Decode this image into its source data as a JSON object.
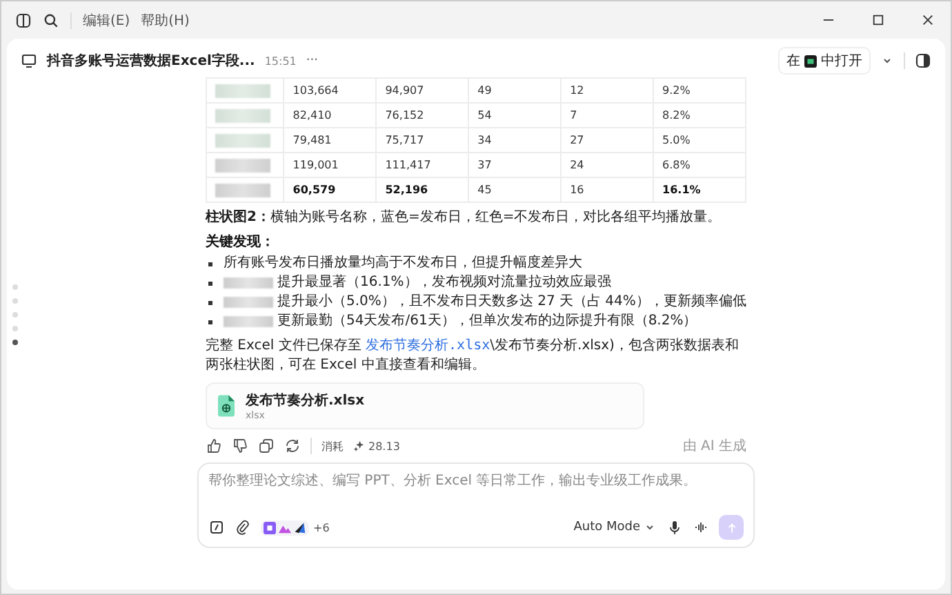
{
  "menu": [
    "编辑(E)",
    "帮助(H)"
  ],
  "conversation": {
    "title": "抖音多账号运营数据Excel字段...",
    "time": "15:51",
    "more": "···",
    "open_in": {
      "before": "在",
      "after": "中打开"
    }
  },
  "timeline": [
    {
      "selected": false
    },
    {
      "selected": false
    },
    {
      "selected": false
    },
    {
      "selected": false
    },
    {
      "selected": true
    }
  ],
  "table": {
    "rows": [
      {
        "cells": [
          {
            "text": "103,664",
            "bold": false
          },
          {
            "text": "94,907",
            "bold": false
          },
          {
            "text": "49",
            "bold": false
          },
          {
            "text": "12",
            "bold": false
          },
          {
            "text": "9.2%",
            "bold": false
          }
        ]
      },
      {
        "cells": [
          {
            "text": "82,410",
            "bold": false
          },
          {
            "text": "76,152",
            "bold": false
          },
          {
            "text": "54",
            "bold": false
          },
          {
            "text": "7",
            "bold": false
          },
          {
            "text": "8.2%",
            "bold": false
          }
        ]
      },
      {
        "cells": [
          {
            "text": "79,481",
            "bold": false
          },
          {
            "text": "75,717",
            "bold": false
          },
          {
            "text": "34",
            "bold": false
          },
          {
            "text": "27",
            "bold": false
          },
          {
            "text": "5.0%",
            "bold": false
          }
        ]
      },
      {
        "cells": [
          {
            "text": "119,001",
            "bold": false
          },
          {
            "text": "111,417",
            "bold": false
          },
          {
            "text": "37",
            "bold": false
          },
          {
            "text": "24",
            "bold": false
          },
          {
            "text": "6.8%",
            "bold": false
          }
        ]
      },
      {
        "cells": [
          {
            "text": "60,579",
            "bold": true
          },
          {
            "text": "52,196",
            "bold": true
          },
          {
            "text": "45",
            "bold": false
          },
          {
            "text": "16",
            "bold": false
          },
          {
            "text": "16.1%",
            "bold": true
          }
        ]
      }
    ]
  },
  "chart_note": "**柱状图2：**横轴为账号名称，蓝色=发布日，红色=不发布日，对比各组平均播放量。",
  "findings_heading": "关键发现：",
  "findings": [
    {
      "redacted_name": false,
      "text": "所有账号发布日播放量均高于不发布日，但提升幅度差异大"
    },
    {
      "redacted_name": true,
      "text": "提升最显著（16.1%），发布视频对流量拉动效应最强"
    },
    {
      "redacted_name": true,
      "text": "提升最小（5.0%），且不发布日天数多达 27 天（占 44%），更新频率偏低"
    },
    {
      "redacted_name": true,
      "text": "更新最勤（54天发布/61天），但单次发布的边际提升有限（8.2%）"
    }
  ],
  "saved": {
    "before": "完整 Excel 文件已保存至 ",
    "link": "发布节奏分析.xlsx",
    "after": "\\发布节奏分析.xlsx)，包含两张数据表和两张柱状图，可在 Excel 中直接查看和编辑。"
  },
  "file": {
    "name": "发布节奏分析.xlsx",
    "type": "xlsx"
  },
  "usage": {
    "label": "消耗",
    "value": "28.13"
  },
  "ai_note": "由 AI 生成",
  "composer": {
    "placeholder": "帮你整理论文综述、编写 PPT、分析 Excel 等日常工作，输出专业级工作成果。",
    "more_apps": "+6",
    "mode": "Auto Mode",
    "send_disabled": true
  }
}
